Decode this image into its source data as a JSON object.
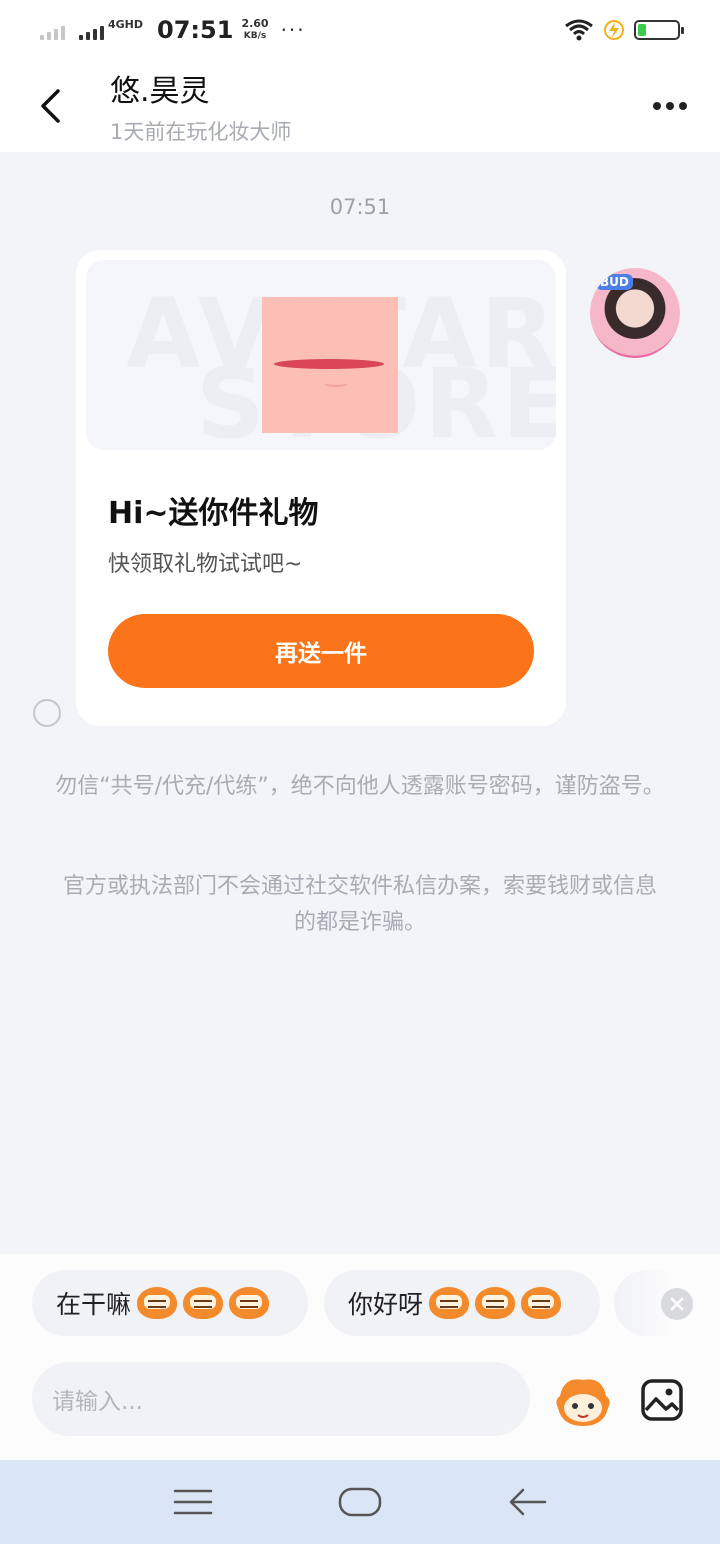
{
  "status_bar": {
    "network": "4GHD",
    "time": "07:51",
    "speed_value": "2.60",
    "speed_unit": "KB/s",
    "dots": "···",
    "battery_level": 0.2
  },
  "header": {
    "title": "悠.昊灵",
    "subtitle": "1天前在玩化妆大师"
  },
  "chat": {
    "timestamp": "07:51",
    "avatar_badge": "BUD",
    "card": {
      "banner_text_1": "AVATAR",
      "banner_text_2": "STORE",
      "title": "Hi~送你件礼物",
      "description": "快领取礼物试试吧~",
      "button_label": "再送一件"
    },
    "notices": [
      "勿信“共号/代充/代练”，绝不向他人透露账号密码，谨防盗号。",
      "官方或执法部门不会通过社交软件私信办案，索要钱财或信息的都是诈骗。"
    ]
  },
  "quick_replies": [
    {
      "label": "在干嘛"
    },
    {
      "label": "你好呀"
    }
  ],
  "input": {
    "placeholder": "请输入..."
  },
  "colors": {
    "accent": "#fb7419",
    "background": "#f2f4f8",
    "nav_bar": "#dae6f5"
  }
}
